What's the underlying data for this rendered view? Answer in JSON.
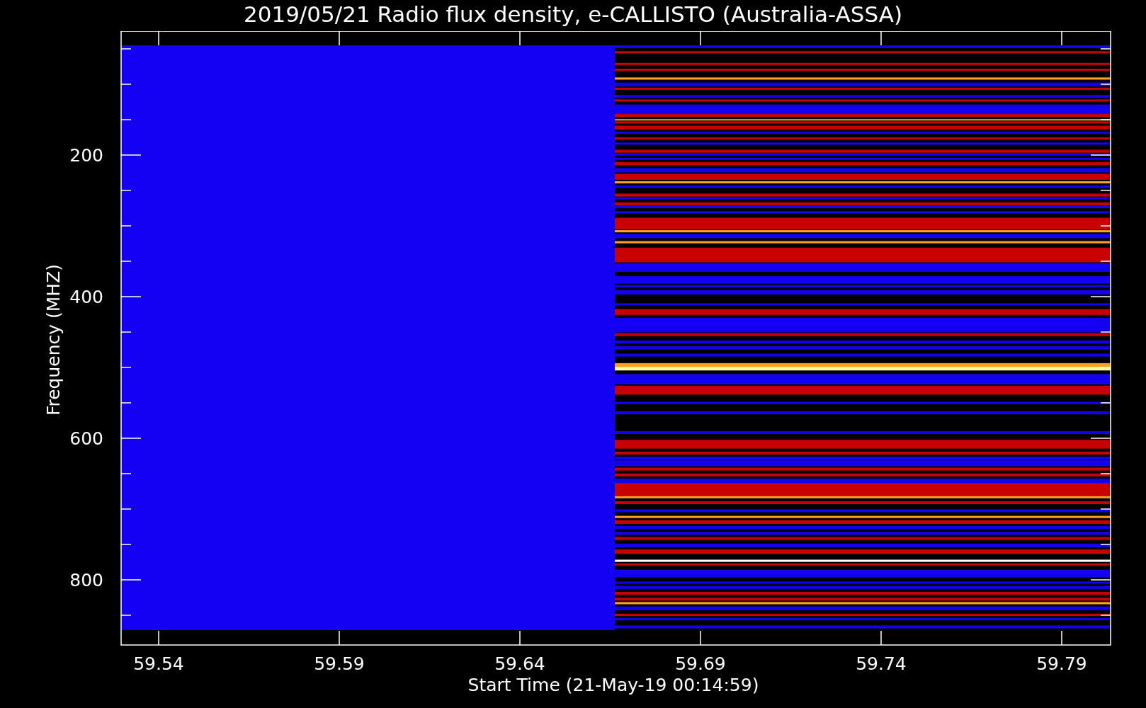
{
  "plot": {
    "title": "2019/05/21  Radio flux density, e-CALLISTO (Australia-ASSA)",
    "x_axis": {
      "label": "Start Time (21-May-19 00:14:59)",
      "tick_labels": [
        "59.54",
        "59.59",
        "59.64",
        "59.69",
        "59.74",
        "59.79"
      ]
    },
    "y_axis": {
      "label": "Frequency (MHZ)",
      "tick_labels": [
        "200",
        "400",
        "600",
        "800"
      ]
    }
  }
}
